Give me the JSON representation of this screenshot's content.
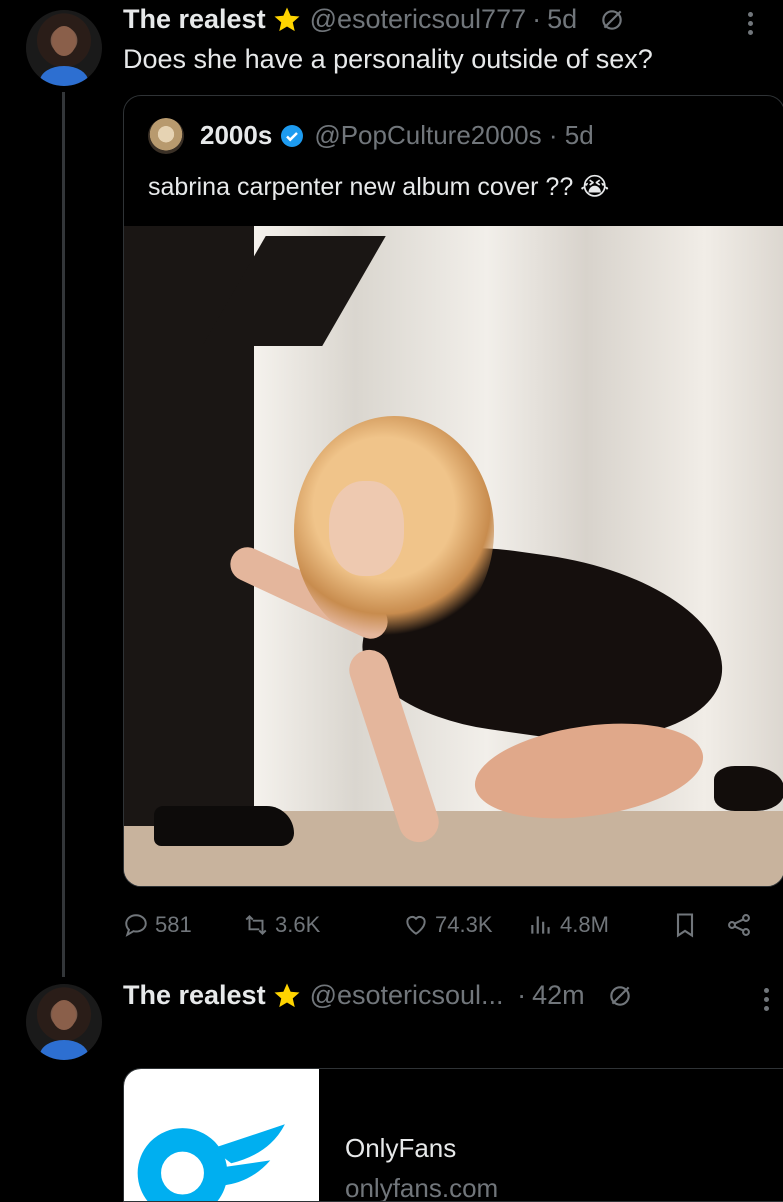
{
  "tweet1": {
    "name": "The realest",
    "handle": "@esotericsoul777",
    "time": "5d",
    "text": "Does she have a personality outside of sex?"
  },
  "quote": {
    "name": "2000s",
    "handle": "@PopCulture2000s",
    "time": "5d",
    "text": "sabrina carpenter new album cover ?? 😭"
  },
  "actions": {
    "replies": "581",
    "reposts": "3.6K",
    "likes": "74.3K",
    "views": "4.8M"
  },
  "tweet2": {
    "name": "The realest",
    "handle": "@esotericsoul...",
    "time": "42m"
  },
  "link_card": {
    "title": "OnlyFans",
    "domain": "onlyfans.com"
  },
  "icons": {
    "verified_star": "star-badge-icon",
    "verified_check": "blue-check-icon",
    "grok": "grok-icon",
    "more": "more-vertical-icon",
    "reply": "reply-icon",
    "repost": "repost-icon",
    "like": "heart-icon",
    "views": "views-icon",
    "bookmark": "bookmark-icon",
    "share": "share-icon"
  },
  "colors": {
    "background": "#000000",
    "text": "#e7e9ea",
    "muted": "#71767b",
    "border": "#2f3336",
    "star": "#ffd400",
    "check": "#1d9bf0",
    "onlyfans": "#00aff0"
  }
}
